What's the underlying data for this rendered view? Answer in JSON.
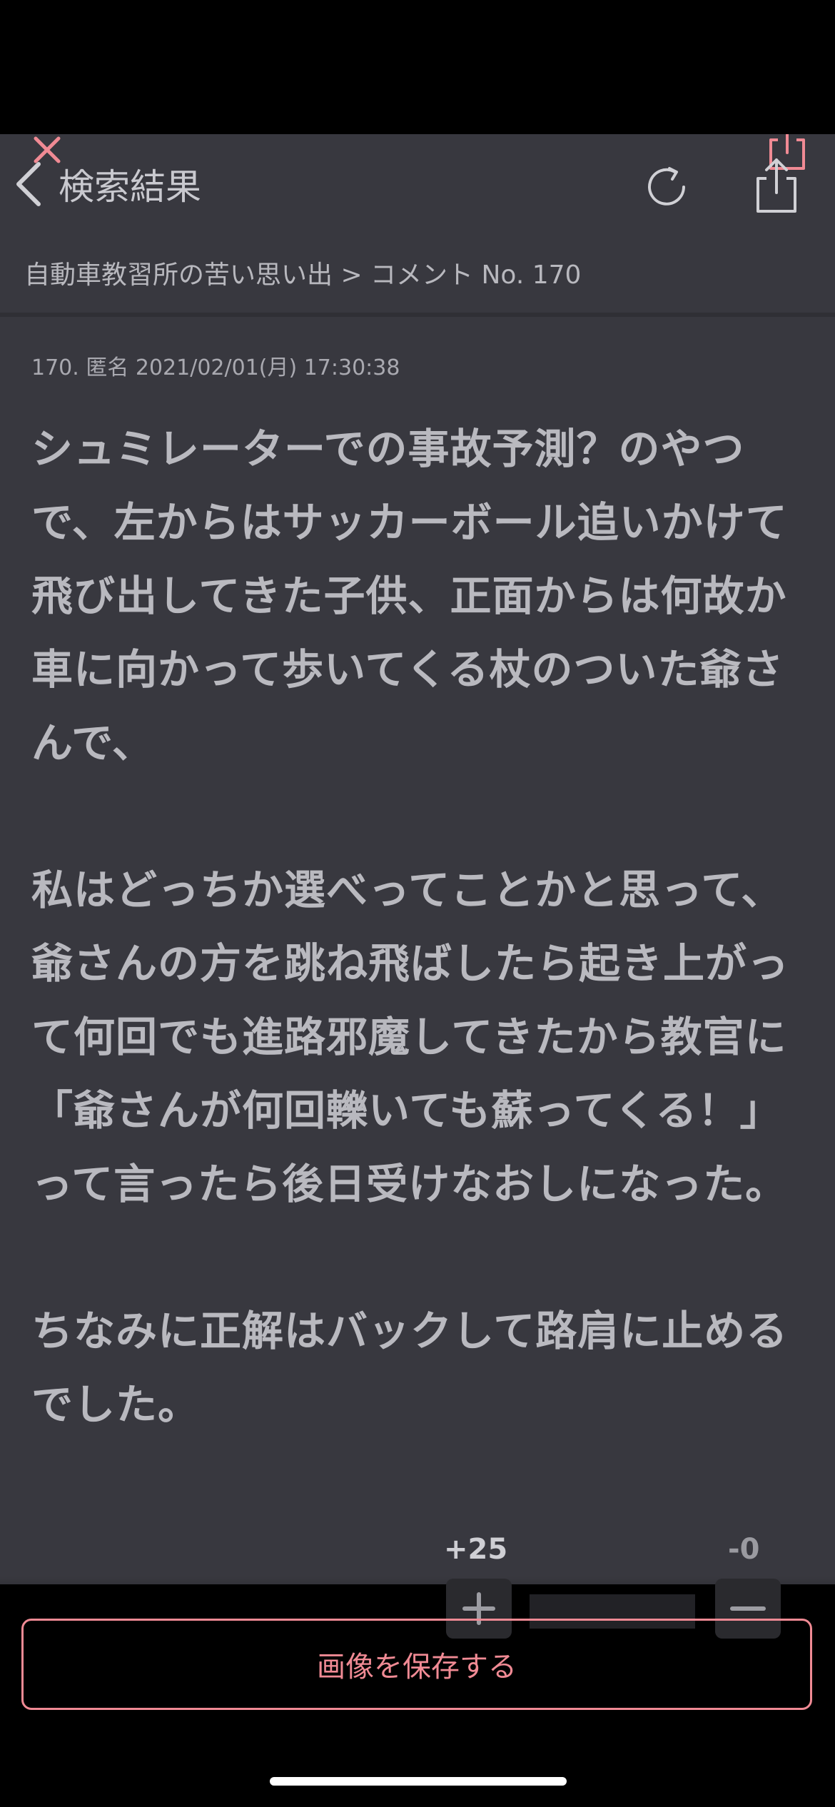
{
  "nav": {
    "back_label": "検索結果"
  },
  "breadcrumb": "自動車教習所の苦い思い出 > コメント No. 170",
  "comment": {
    "meta": "170. 匿名 2021/02/01(月) 17:30:38",
    "paragraphs": [
      "シュミレーターでの事故予測？のやつで、左からはサッカーボール追いかけて飛び出してきた子供、正面からは何故か車に向かって歩いてくる杖のついた爺さんで、",
      "私はどっちか選べってことかと思って、爺さんの方を跳ね飛ばしたら起き上がって何回でも進路邪魔してきたから教官に「爺さんが何回轢いても蘇ってくる！」って言ったら後日受けなおしになった。",
      "ちなみに正解はバックして路肩に止めるでした。"
    ]
  },
  "votes": {
    "plus_count": "+25",
    "minus_count": "-0",
    "plus_symbol": "+",
    "minus_symbol": "−"
  },
  "footer": {
    "save_label": "画像を保存する"
  },
  "colors": {
    "background": "#38383f",
    "accent": "#f08a94",
    "text": "#b9b9bf"
  }
}
